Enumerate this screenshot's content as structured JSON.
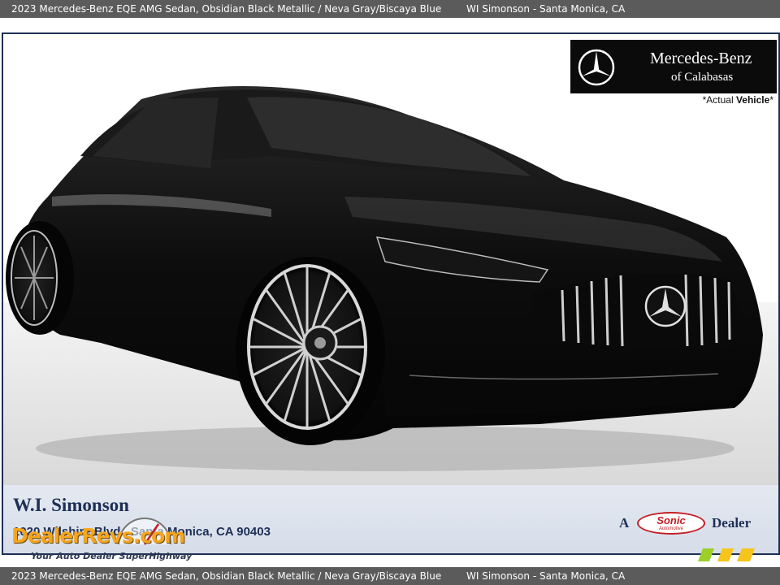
{
  "header": {
    "title": "2023 Mercedes-Benz EQE AMG Sedan,  Obsidian Black Metallic / Neva Gray/Biscaya Blue",
    "dealer": "WI Simonson - Santa Monica, CA"
  },
  "footer_bar": {
    "title": "2023 Mercedes-Benz EQE AMG Sedan,  Obsidian Black Metallic / Neva Gray/Biscaya Blue",
    "dealer": "WI Simonson - Santa Monica, CA"
  },
  "logo": {
    "line1": "Mercedes-Benz",
    "line2": "of Calabasas",
    "icon": "mercedes-star-icon"
  },
  "badge": {
    "prefix": "*Actual ",
    "emphasis": "Vehicle",
    "suffix": "*"
  },
  "dealer": {
    "name": "W.I. Simonson",
    "address": "1020 Wilshire Blvd., Santa Monica, CA 90403"
  },
  "sonic": {
    "prefix": "A",
    "logo_text": "Sonic",
    "logo_subtext": "Automotive",
    "suffix": "Dealer"
  },
  "watermark": {
    "text": "DealerRevs.com",
    "tagline": "Your Auto Dealer SuperHighway"
  },
  "colors": {
    "bar_bg": "#5b5b5b",
    "frame": "#1e2f56",
    "dealer_text": "#1e2f56",
    "sonic_red": "#c41e24",
    "watermark_orange": "#f5a51d"
  }
}
